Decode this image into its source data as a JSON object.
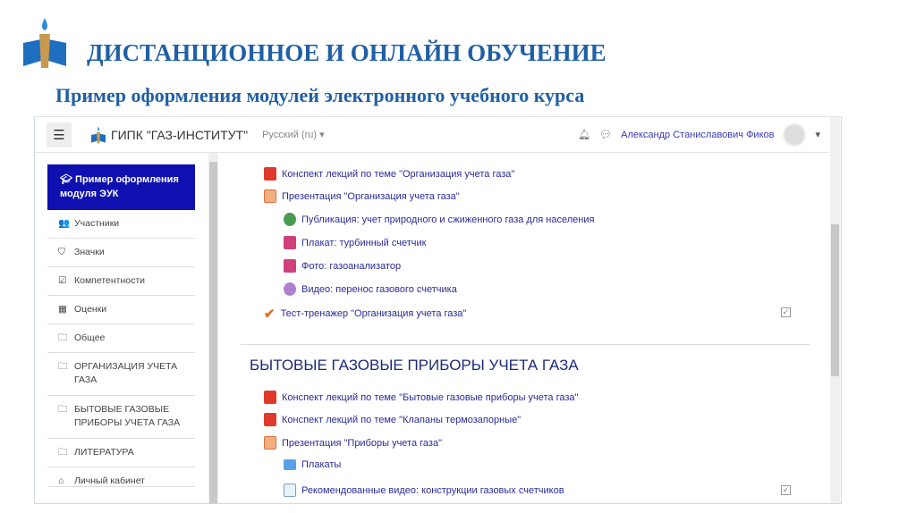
{
  "slide": {
    "title": "ДИСТАНЦИОННОЕ И ОНЛАЙН ОБУЧЕНИЕ",
    "subtitle": "Пример оформления модулей электронного учебного курса"
  },
  "navbar": {
    "menu_icon": "☰",
    "brand": "ГИПК \"ГАЗ-ИНСТИТУТ\"",
    "language": "Русский (ru) ▾",
    "user": "Александр Станиславович Фиков",
    "dropdown": "▾"
  },
  "sidebar": {
    "active": "Пример оформления модуля ЭУК",
    "items": [
      {
        "label": "Участники",
        "icon": "👥"
      },
      {
        "label": "Значки",
        "icon": "⛉"
      },
      {
        "label": "Компетентности",
        "icon": "☑"
      },
      {
        "label": "Оценки",
        "icon": "▦"
      },
      {
        "label": "Общее",
        "icon": "🗀"
      },
      {
        "label": "ОРГАНИЗАЦИЯ УЧЕТА ГАЗА",
        "icon": "🗀"
      },
      {
        "label": "БЫТОВЫЕ ГАЗОВЫЕ ПРИБОРЫ УЧЕТА ГАЗА",
        "icon": "🗀"
      },
      {
        "label": "ЛИТЕРАТУРА",
        "icon": "🗀"
      },
      {
        "label": "Личный кабинет",
        "icon": "⌂"
      }
    ]
  },
  "section1": {
    "activities": [
      {
        "label": "Конспект лекций по теме \"Организация учета газа\"",
        "type": "pdf"
      },
      {
        "label": "Презентация \"Организация учета газа\"",
        "type": "ppt"
      },
      {
        "label": "Публикация: учет природного и сжиженного газа для населения",
        "type": "web"
      },
      {
        "label": "Плакат: турбинный счетчик",
        "type": "img"
      },
      {
        "label": "Фото: газоанализатор",
        "type": "img"
      },
      {
        "label": "Видео: перенос газового счетчика",
        "type": "vid"
      },
      {
        "label": "Тест-тренажер \"Организация учета газа\"",
        "type": "quiz"
      }
    ]
  },
  "section2": {
    "title": "БЫТОВЫЕ ГАЗОВЫЕ ПРИБОРЫ УЧЕТА ГАЗА",
    "activities": [
      {
        "label": "Конспект лекций по теме \"Бытовые газовые приборы учета газа\"",
        "type": "pdf"
      },
      {
        "label": "Конспект лекций по теме \"Клапаны термозапорные\"",
        "type": "pdf"
      },
      {
        "label": "Презентация \"Приборы учета газа\"",
        "type": "ppt"
      },
      {
        "label": "Плакаты",
        "type": "folder"
      },
      {
        "label": "Рекомендованные видео: конструкции газовых счетчиков",
        "type": "page"
      }
    ]
  },
  "check": "✓"
}
